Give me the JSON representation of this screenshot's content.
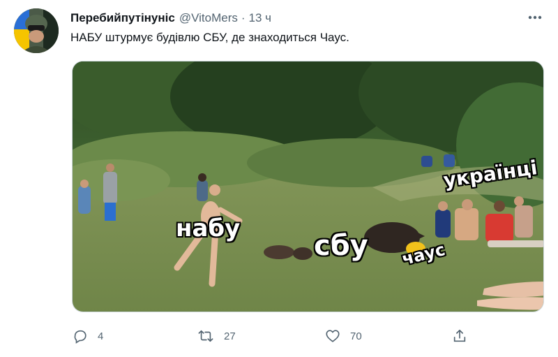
{
  "tweet": {
    "author_name": "Перебийпутінуніс",
    "author_handle": "@VitoMers",
    "separator": "·",
    "time": "13 ч",
    "text": "НАБУ штурмує будівлю СБУ, де знаходиться Чаус."
  },
  "meme": {
    "caption_nabu": "набу",
    "caption_sbu": "сбу",
    "caption_ukrainians": "українці",
    "caption_chaus": "чаус"
  },
  "actions": {
    "reply_count": "4",
    "retweet_count": "27",
    "like_count": "70"
  },
  "icons": {
    "more": "more-horizontal-icon",
    "reply": "reply-icon",
    "retweet": "retweet-icon",
    "like": "heart-icon",
    "share": "share-icon"
  },
  "colors": {
    "text_primary": "#0f1419",
    "text_secondary": "#536471"
  }
}
